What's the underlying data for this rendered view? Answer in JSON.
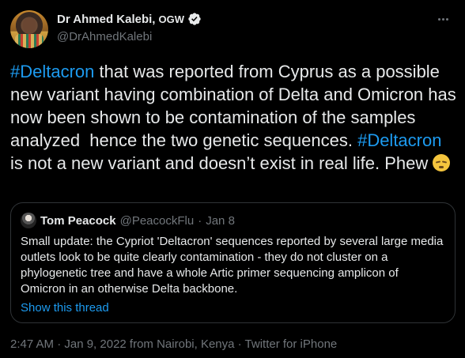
{
  "author": {
    "name": "Dr Ahmed Kalebi, ",
    "name_suffix": "OGW",
    "handle": "@DrAhmedKalebi"
  },
  "tweet": {
    "hashtag1": "#Deltacron",
    "text1": " that was reported from Cyprus as a possible new variant having combination of Delta and Omicron has now been shown to be contamination of the samples analyzed  hence the two genetic sequences. ",
    "hashtag2": "#Deltacron",
    "text2": " is not a new variant and doesn’t exist in real life. Phew ",
    "emoji": "relieved-face"
  },
  "quote": {
    "name": "Tom Peacock",
    "handle": "@PeacockFlu",
    "separator": "·",
    "date": "Jan 8",
    "body": "Small update: the Cypriot 'Deltacron' sequences reported by several large media outlets look to be quite clearly contamination - they do not cluster on a phylogenetic tree and have a whole Artic primer sequencing amplicon of Omicron in an otherwise Delta backbone.",
    "show_thread": "Show this thread"
  },
  "meta": {
    "timestamp": "2:47 AM · Jan 9, 2022 from Nairobi, Kenya · Twitter for iPhone"
  },
  "colors": {
    "accent": "#1d9bf0",
    "background": "#000000",
    "secondary_text": "#71767b"
  }
}
